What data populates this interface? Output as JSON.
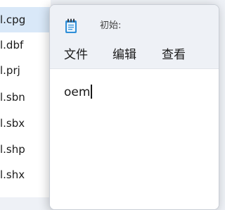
{
  "explorer": {
    "files": [
      {
        "name": "l.cpg",
        "selected": true
      },
      {
        "name": "l.dbf",
        "selected": false
      },
      {
        "name": "l.prj",
        "selected": false
      },
      {
        "name": "l.sbn",
        "selected": false
      },
      {
        "name": "l.sbx",
        "selected": false
      },
      {
        "name": "l.shp",
        "selected": false
      },
      {
        "name": "l.shx",
        "selected": false
      }
    ]
  },
  "notepad": {
    "icon": "notepad-icon",
    "title": "初始:",
    "menu": {
      "file": "文件",
      "edit": "编辑",
      "view": "查看"
    },
    "content": "oem"
  },
  "colors": {
    "selected_row": "#d9e8f8",
    "titlebar_bg": "#eef1f6",
    "icon_blue": "#2f8fd8"
  }
}
